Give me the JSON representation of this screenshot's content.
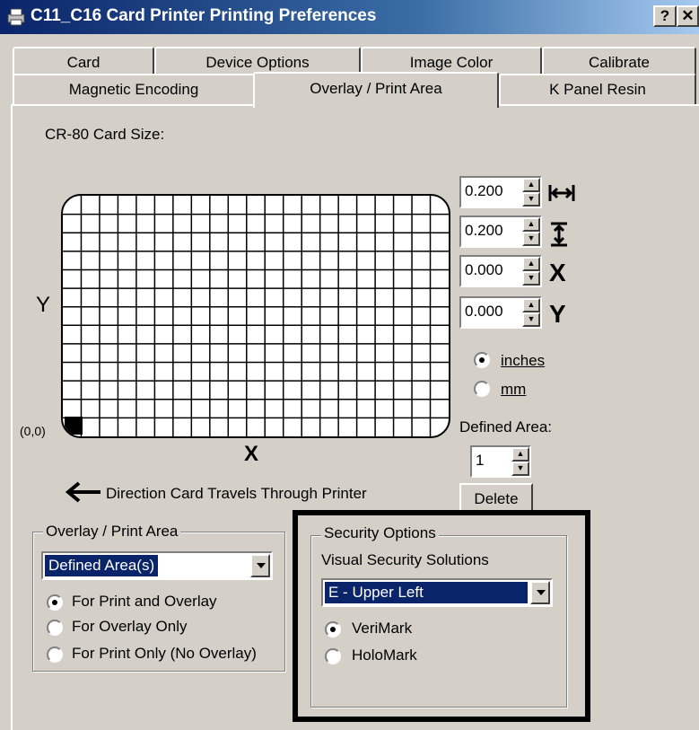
{
  "window": {
    "title": "C11_C16 Card Printer Printing Preferences",
    "help_label": "?",
    "close_label": "✕"
  },
  "tabs": {
    "row1": [
      "Card",
      "Device Options",
      "Image Color",
      "Calibrate"
    ],
    "row2": [
      "Magnetic Encoding",
      "Overlay / Print Area",
      "K Panel Resin"
    ],
    "active": "Overlay / Print Area"
  },
  "card_area": {
    "size_label": "CR-80 Card Size:",
    "y_label": "Y",
    "x_label": "X",
    "origin_label": "(0,0)",
    "direction_text": "Direction Card Travels Through Printer"
  },
  "dimensions": {
    "width": "0.200",
    "height": "0.200",
    "x": "0.000",
    "y": "0.000",
    "x_icon_label": "X",
    "y_icon_label": "Y"
  },
  "units": {
    "inches_label": "inches",
    "mm_label": "mm",
    "selected": "inches"
  },
  "defined_area": {
    "label": "Defined Area:",
    "value": "1",
    "delete_label": "Delete"
  },
  "overlay_group": {
    "title": "Overlay / Print Area",
    "dropdown_value": "Defined Area(s)",
    "options": [
      "For Print and Overlay",
      "For Overlay Only",
      "For Print Only (No Overlay)"
    ],
    "selected_index": 0
  },
  "security_group": {
    "title": "Security Options",
    "subtitle": "Visual Security Solutions",
    "dropdown_value": "E - Upper Left",
    "options": [
      "VeriMark",
      "HoloMark"
    ],
    "selected_index": 0
  }
}
